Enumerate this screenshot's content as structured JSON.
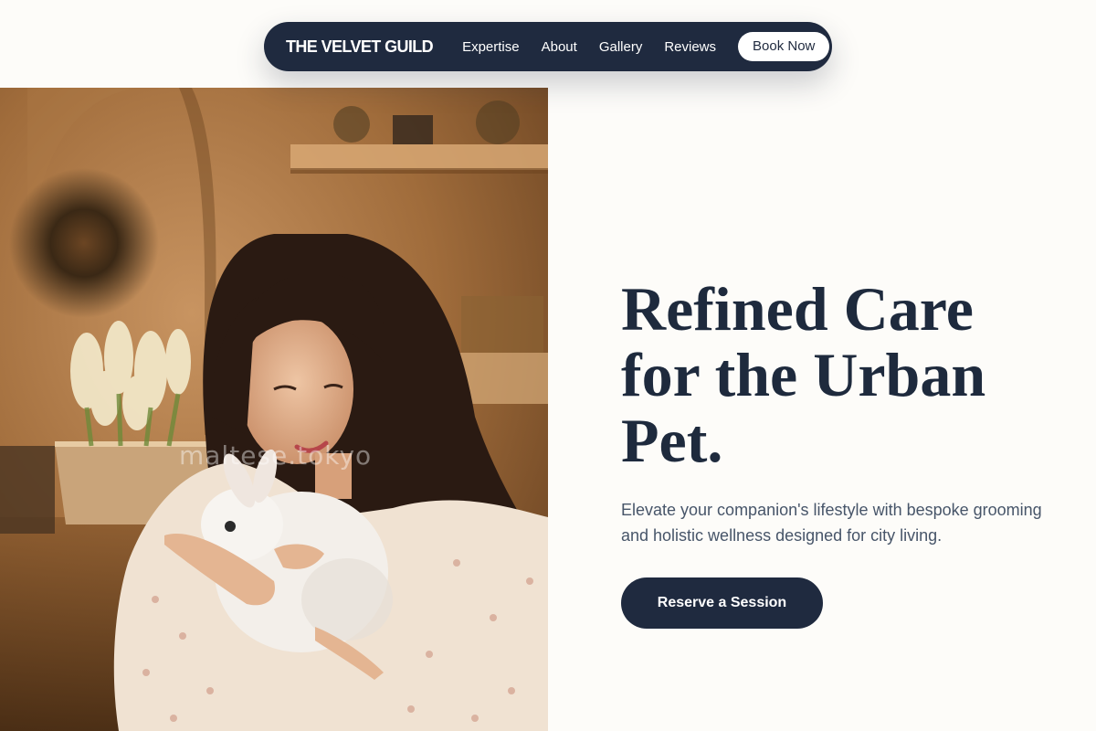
{
  "nav": {
    "brand": "THE VELVET GUILD",
    "links": [
      "Expertise",
      "About",
      "Gallery",
      "Reviews"
    ],
    "book_label": "Book Now"
  },
  "hero": {
    "image_watermark": "maltese.tokyo",
    "headline": "Refined Care for the Urban Pet.",
    "subtext": "Elevate your companion's lifestyle with bespoke grooming and holistic wellness designed for city living.",
    "cta_label": "Reserve a Session"
  },
  "colors": {
    "navy": "#1f2a3f",
    "page_bg": "#fdfcf9",
    "body_text": "#475569"
  }
}
